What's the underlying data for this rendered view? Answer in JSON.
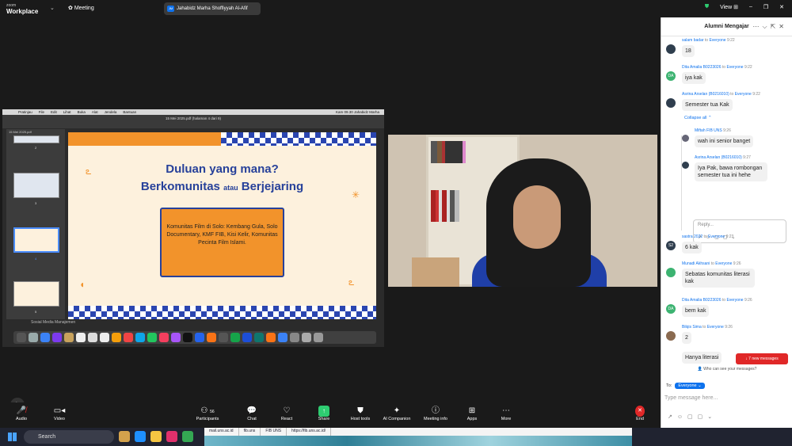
{
  "app": {
    "logo_top": "zoom",
    "logo_bottom": "Workplace",
    "meeting": "Meeting",
    "sharing": "Jahabidz Marha Shoffiyyah Al-Afif",
    "sharing_initials": "JM",
    "view": "View"
  },
  "shared_screen": {
    "menubar": [
      "Pratinjau",
      "File",
      "Edit",
      "Lihat",
      "Buka",
      "Alat",
      "Jendela",
      "Bantuan"
    ],
    "menubar_right": "Kam 09.30  Jahabidz Marha",
    "window_title": "15 Mei 2025.pdf (halaman 4 dari 9)",
    "sidebar_label": "15 Mei 2025.pdf",
    "thumb_numbers": [
      "2",
      "3",
      "4",
      "5"
    ],
    "slide": {
      "title_line1": "Duluan yang mana?",
      "title_line2_a": "Berkomunitas",
      "title_line2_b": "atau",
      "title_line2_c": "Berjejaring",
      "box_text": "Komunitas Film di Solo: Kembang Gula, Solo Documentary, KMF FIB, Kisi Kelir, Komunitas Pecinta Film Islami."
    },
    "dock_hover": "Sosial Media Manajemen"
  },
  "chat": {
    "title": "Alumni Mengajar",
    "messages": [
      {
        "name": "salam badar",
        "to": "to",
        "target": "Everyone",
        "time": "9:22",
        "text": "18",
        "initials": ""
      },
      {
        "name": "Dita Amalia B0223026",
        "to": "to",
        "target": "Everyone",
        "time": "9:22",
        "text": "iya kak",
        "initials": "DA"
      },
      {
        "name": "Asrina Arselan (B0216010)",
        "to": "to",
        "target": "Everyone",
        "time": "9:22",
        "text": "Semester tua Kak",
        "initials": ""
      },
      {
        "name": "Miftah FIB UNS",
        "to": "",
        "target": "",
        "time": "9:26",
        "text": "wah ini senior banget",
        "initials": ""
      },
      {
        "name": "Asrina Arselan (B0216010)",
        "to": "",
        "target": "",
        "time": "9:27",
        "text": "Iya Pak, bawa rombongan semester tua ini hehe",
        "initials": ""
      },
      {
        "name": "sastra 2022",
        "to": "to",
        "target": "Everyone",
        "time": "9:23",
        "text": "6 kak",
        "initials": "S2"
      },
      {
        "name": "Munadi Akhsani",
        "to": "to",
        "target": "Everyone",
        "time": "9:26",
        "text": "Sebatas komunitas literasi kak",
        "initials": ""
      },
      {
        "name": "Dita Amalia B0223026",
        "to": "to",
        "target": "Everyone",
        "time": "9:26",
        "text": "bem kak",
        "initials": "DA"
      },
      {
        "name": "Bilqis Sima",
        "to": "to",
        "target": "Everyone",
        "time": "9:26",
        "text": "2",
        "initials": ""
      },
      {
        "name": "",
        "to": "",
        "target": "",
        "time": "",
        "text": "Hanya literasi",
        "initials": ""
      }
    ],
    "collapse": "Collapse all",
    "reply_placeholder": "Reply...",
    "new_messages": "7 new messages",
    "who_can_see": "Who can see your messages?",
    "to_label": "To:",
    "to_value": "Everyone",
    "input_placeholder": "Type message here..."
  },
  "toolbar": {
    "audio": "Audio",
    "video": "Video",
    "participants": "Participants",
    "participants_count": "56",
    "chat": "Chat",
    "react": "React",
    "share": "Share",
    "host_tools": "Host tools",
    "ai": "AI Companion",
    "meeting_info": "Meeting info",
    "apps": "Apps",
    "more": "More",
    "end": "End"
  },
  "taskbar": {
    "search": "Search",
    "tabs": [
      "mail.uns.ac.id",
      "fib.uns",
      "FIB UNS",
      "https://fib.uns.ac.id/"
    ]
  }
}
